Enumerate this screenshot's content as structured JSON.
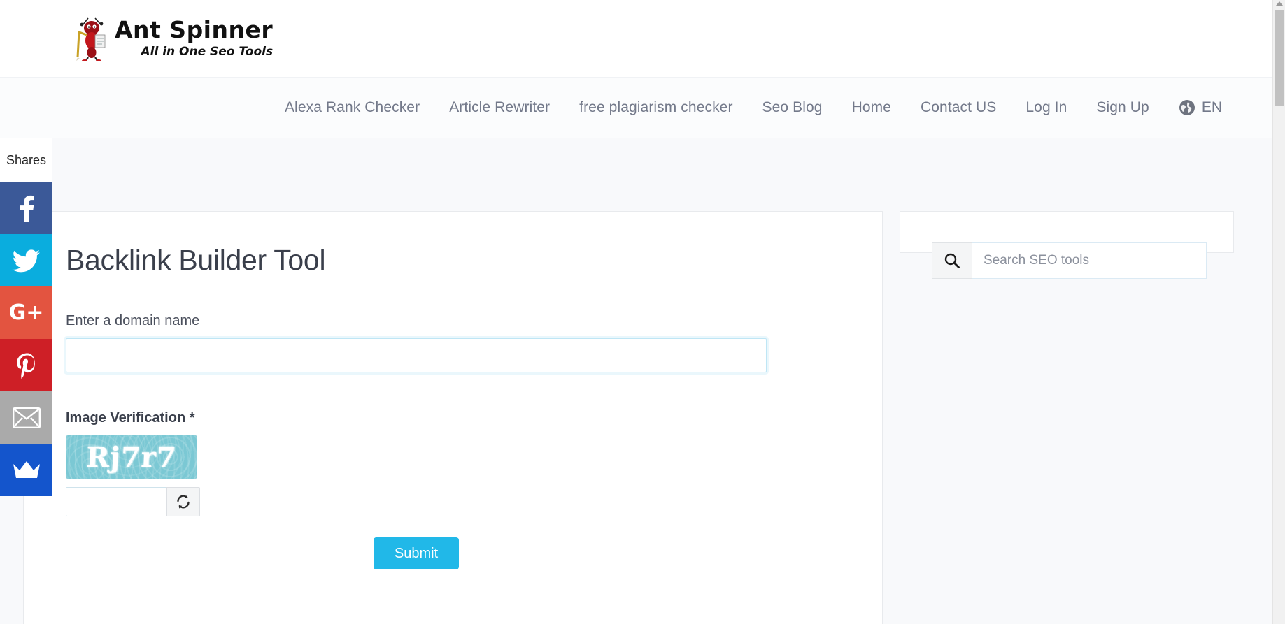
{
  "site": {
    "logo_name": "Ant Spinner",
    "logo_tagline": "All in One Seo Tools",
    "logo_icon": "ant-mascot-icon"
  },
  "nav": {
    "items": [
      {
        "label": "Alexa Rank Checker",
        "name": "nav-alexa-rank-checker"
      },
      {
        "label": "Article Rewriter",
        "name": "nav-article-rewriter"
      },
      {
        "label": "free plagiarism checker",
        "name": "nav-free-plagiarism-checker"
      },
      {
        "label": "Seo Blog",
        "name": "nav-seo-blog"
      },
      {
        "label": "Home",
        "name": "nav-home"
      },
      {
        "label": "Contact US",
        "name": "nav-contact-us"
      },
      {
        "label": "Log In",
        "name": "nav-log-in"
      },
      {
        "label": "Sign Up",
        "name": "nav-sign-up"
      }
    ],
    "language": "EN",
    "language_icon": "globe-icon"
  },
  "social": {
    "shares_label": "Shares",
    "buttons": [
      {
        "label": "Facebook",
        "icon": "facebook-icon",
        "color": "#3b5998"
      },
      {
        "label": "Twitter",
        "icon": "twitter-icon",
        "color": "#0aadde"
      },
      {
        "label": "Google Plus",
        "icon": "google-plus-icon",
        "color": "#e35440"
      },
      {
        "label": "Pinterest",
        "icon": "pinterest-icon",
        "color": "#ce1f26"
      },
      {
        "label": "Email",
        "icon": "email-icon",
        "color": "#aaaaaa"
      },
      {
        "label": "SumoMe",
        "icon": "crown-icon",
        "color": "#1455cc"
      }
    ]
  },
  "tool": {
    "title": "Backlink Builder Tool",
    "domain_label": "Enter a domain name",
    "domain_value": "",
    "domain_placeholder": "",
    "verification_label": "Image Verification *",
    "captcha_text": "Rj7r7",
    "captcha_input_value": "",
    "refresh_icon": "refresh-icon",
    "submit_label": "Submit",
    "accent_color": "#21b8e8"
  },
  "sidebar": {
    "search_placeholder": "Search SEO tools",
    "search_value": "",
    "search_icon": "search-icon"
  }
}
